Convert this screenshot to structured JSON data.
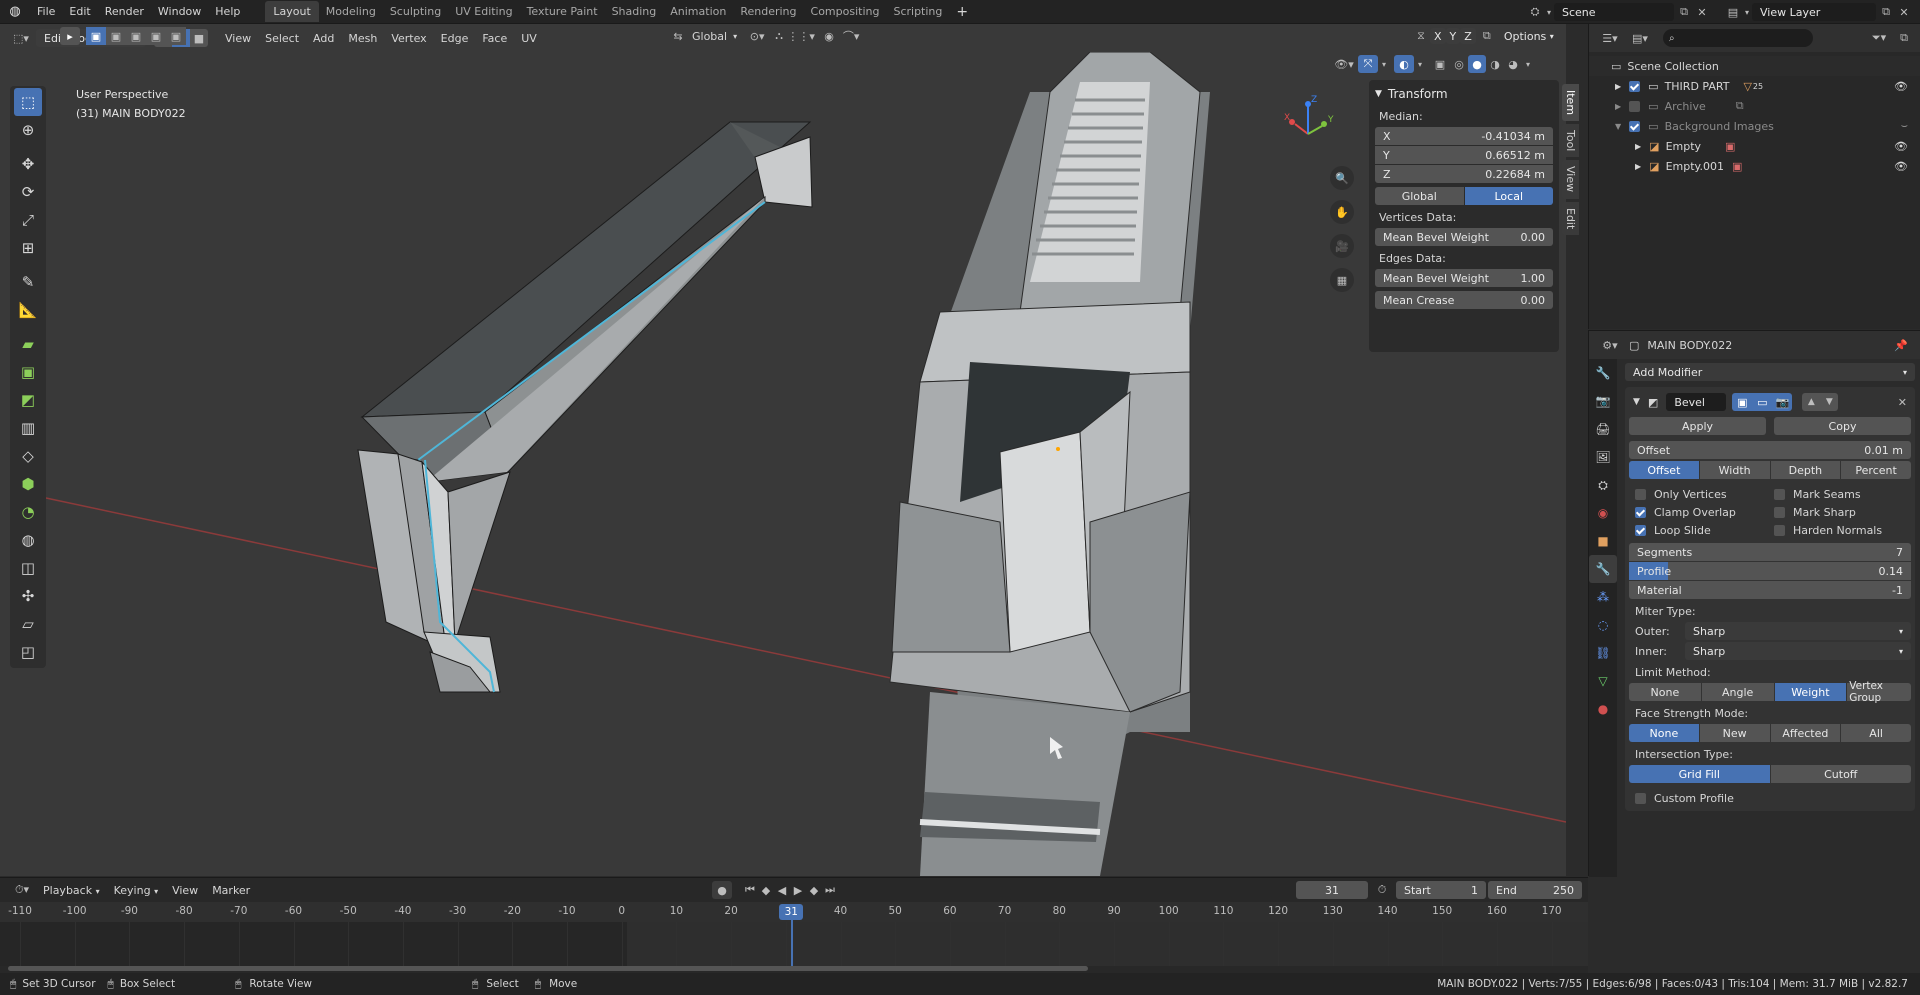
{
  "topbar": {
    "menus": [
      "File",
      "Edit",
      "Render",
      "Window",
      "Help"
    ],
    "workspaces": [
      "Layout",
      "Modeling",
      "Sculpting",
      "UV Editing",
      "Texture Paint",
      "Shading",
      "Animation",
      "Rendering",
      "Compositing",
      "Scripting"
    ],
    "active_workspace": "Layout",
    "add_workspace": "+",
    "scene": "Scene",
    "view_layer": "View Layer"
  },
  "viewport_header": {
    "mode": "Edit Mode",
    "menus": [
      "View",
      "Select",
      "Add",
      "Mesh",
      "Vertex",
      "Edge",
      "Face",
      "UV"
    ],
    "orientation": "Global",
    "options": "Options",
    "axis_x": "X",
    "axis_y": "Y",
    "axis_z": "Z"
  },
  "viewport": {
    "perspective": "User Perspective",
    "object_info": "(31) MAIN BODY022",
    "gizmo_x": "X",
    "gizmo_y": "Y",
    "gizmo_z": "Z"
  },
  "sidebar_tabs": [
    "Item",
    "Tool",
    "View",
    "Edit"
  ],
  "transform": {
    "title": "Transform",
    "median_label": "Median:",
    "x_label": "X",
    "x": "-0.41034 m",
    "y_label": "Y",
    "y": "0.66512 m",
    "z_label": "Z",
    "z": "0.22684 m",
    "global": "Global",
    "local": "Local",
    "vertices_data": "Vertices Data:",
    "mean_bevel_weight_label": "Mean Bevel Weight",
    "v_mean_bevel_weight": "0.00",
    "edges_data": "Edges Data:",
    "e_mean_bevel_weight": "1.00",
    "mean_crease_label": "Mean Crease",
    "mean_crease": "0.00"
  },
  "outliner": {
    "search_placeholder": "",
    "scene_collection": "Scene Collection",
    "items": [
      {
        "name": "THIRD PART",
        "badge": "25",
        "visible": true
      },
      {
        "name": "Archive",
        "visible": false
      },
      {
        "name": "Background Images",
        "visible": false
      },
      {
        "name": "Empty",
        "visible": true
      },
      {
        "name": "Empty.001",
        "visible": true
      }
    ]
  },
  "properties": {
    "object_name": "MAIN BODY.022",
    "add_modifier": "Add Modifier",
    "modifier_name": "Bevel",
    "apply": "Apply",
    "copy": "Copy",
    "offset_label": "Offset",
    "offset_value": "0.01 m",
    "offset_modes": [
      "Offset",
      "Width",
      "Depth",
      "Percent"
    ],
    "offset_mode_active": "Offset",
    "only_vertices": "Only Vertices",
    "mark_seams": "Mark Seams",
    "clamp_overlap": "Clamp Overlap",
    "mark_sharp": "Mark Sharp",
    "loop_slide": "Loop Slide",
    "harden_normals": "Harden Normals",
    "segments_label": "Segments",
    "segments": "7",
    "profile_label": "Profile",
    "profile": "0.14",
    "profile_fraction": 0.14,
    "material_label": "Material",
    "material": "-1",
    "miter_type": "Miter Type:",
    "outer_label": "Outer:",
    "outer": "Sharp",
    "inner_label": "Inner:",
    "inner": "Sharp",
    "limit_method": "Limit Method:",
    "limit_methods": [
      "None",
      "Angle",
      "Weight",
      "Vertex Group"
    ],
    "limit_active": "Weight",
    "face_strength_mode": "Face Strength Mode:",
    "face_strength_modes": [
      "None",
      "New",
      "Affected",
      "All"
    ],
    "face_strength_active": "None",
    "intersection_type": "Intersection Type:",
    "intersection_types": [
      "Grid Fill",
      "Cutoff"
    ],
    "intersection_active": "Grid Fill",
    "custom_profile": "Custom Profile"
  },
  "timeline": {
    "menus": [
      "Playback",
      "Keying",
      "View",
      "Marker"
    ],
    "current_frame": "31",
    "start_label": "Start",
    "start": "1",
    "end_label": "End",
    "end": "250",
    "ticks": [
      "-110",
      "-100",
      "-90",
      "-80",
      "-70",
      "-60",
      "-50",
      "-40",
      "-30",
      "-20",
      "-10",
      "0",
      "10",
      "20",
      "30",
      "40",
      "50",
      "60",
      "70",
      "80",
      "90",
      "100",
      "110",
      "120",
      "130",
      "140",
      "150",
      "160",
      "170"
    ],
    "playhead": "31"
  },
  "statusbar": {
    "hint1": "Set 3D Cursor",
    "hint2": "Box Select",
    "hint3": "Rotate View",
    "hint4": "Select",
    "hint5": "Move",
    "stats": "MAIN BODY.022 | Verts:7/55 | Edges:6/98 | Faces:0/43 | Tris:104 | Mem: 31.7 MiB | v2.82.7"
  },
  "colors": {
    "accent": "#4772b3",
    "background": "#2b2b2b",
    "viewport": "#393939"
  }
}
